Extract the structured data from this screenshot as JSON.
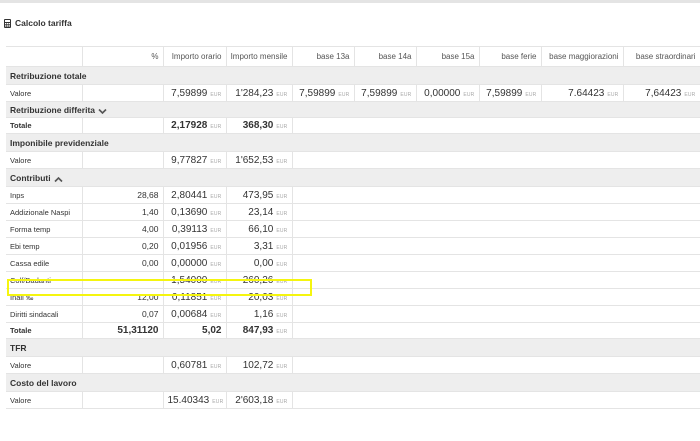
{
  "page": {
    "title": "Calcolo tariffa",
    "icon": "calculator-icon",
    "currency_unit": "EUR",
    "highlight_color": "#f5f50f"
  },
  "columns": [
    "%",
    "Importo orario",
    "Importo mensile",
    "base 13a",
    "base 14a",
    "base 15a",
    "base ferie",
    "base maggiorazioni",
    "base straordinari"
  ],
  "sections": {
    "retribuzione_totale": {
      "title": "Retribuzione totale",
      "row": {
        "label": "Valore",
        "orario": "7,59899",
        "mensile": "1'284,23",
        "b13": "7,59899",
        "b14": "7,59899",
        "b15": "0,00000",
        "ferie": "7,59899",
        "magg": "7.64423",
        "straord": "7,64423"
      }
    },
    "retribuzione_differita": {
      "title": "Retribuzione differita",
      "row": {
        "label": "Totale",
        "orario": "2,17928",
        "mensile": "368,30"
      }
    },
    "imponibile": {
      "title": "Imponibile previdenziale",
      "row": {
        "label": "Valore",
        "orario": "9,77827",
        "mensile": "1'652,53"
      }
    },
    "contributi": {
      "title": "Contributi",
      "rows": [
        {
          "label": "Inps",
          "pct": "28,68",
          "orario": "2,80441",
          "mensile": "473,95"
        },
        {
          "label": "Addizionale Naspi",
          "pct": "1,40",
          "orario": "0,13690",
          "mensile": "23,14"
        },
        {
          "label": "Forma temp",
          "pct": "4,00",
          "orario": "0,39113",
          "mensile": "66,10"
        },
        {
          "label": "Ebi temp",
          "pct": "0,20",
          "orario": "0,01956",
          "mensile": "3,31"
        },
        {
          "label": "Cassa edile",
          "pct": "0,00",
          "orario": "0,00000",
          "mensile": "0,00"
        },
        {
          "label": "Colf/Badanti",
          "pct": "",
          "orario": "1,54000",
          "mensile": "260,26"
        },
        {
          "label": "Inail ‰",
          "pct": "12,00",
          "orario": "0,11851",
          "mensile": "20,03"
        },
        {
          "label": "Diritti sindacali",
          "pct": "0,07",
          "orario": "0,00684",
          "mensile": "1,16"
        }
      ],
      "total": {
        "label": "Totale",
        "pct": "51,31120",
        "orario": "5,02",
        "mensile": "847,93"
      }
    },
    "tfr": {
      "title": "TFR",
      "row": {
        "label": "Valore",
        "orario": "0,60781",
        "mensile": "102,72"
      }
    },
    "costo_lavoro": {
      "title": "Costo del lavoro",
      "row": {
        "label": "Valore",
        "orario": "15.40343",
        "mensile": "2'603,18"
      }
    }
  }
}
